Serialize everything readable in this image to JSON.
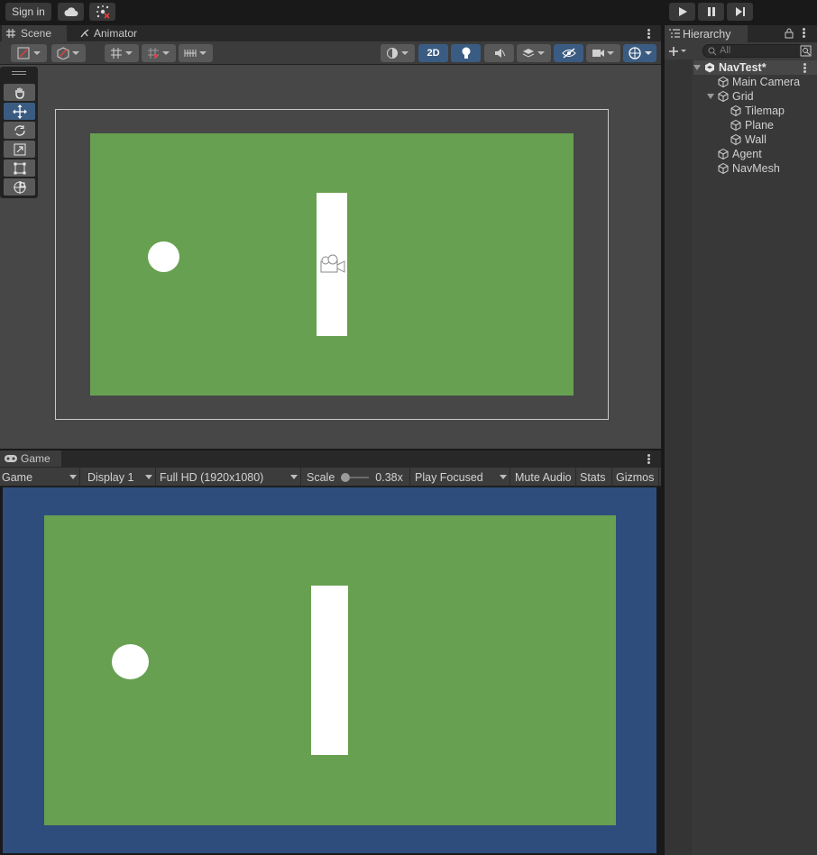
{
  "topbar": {
    "signin_label": "Sign in",
    "cloud_icon": "cloud-icon",
    "collab_icon": "collab-icon",
    "play_icon": "play-icon",
    "pause_icon": "pause-icon",
    "step_icon": "step-icon"
  },
  "scene": {
    "tabs": [
      {
        "label": "Scene",
        "icon": "grid-icon",
        "active": true
      },
      {
        "label": "Animator",
        "icon": "animator-icon",
        "active": false
      }
    ],
    "toolbar": {
      "mode_2d": "2D"
    },
    "tools": [
      "hand-tool-icon",
      "move-tool-icon",
      "rotate-tool-icon",
      "scale-tool-icon",
      "rect-tool-icon",
      "transform-tool-icon"
    ],
    "active_tool": "move-tool-icon"
  },
  "game": {
    "tab_label": "Game",
    "toolbar": {
      "view_select": "Game",
      "display_select": "Display 1",
      "resolution_select": "Full HD (1920x1080)",
      "scale_label": "Scale",
      "scale_value": "0.38x",
      "play_mode_select": "Play Focused",
      "mute_audio": "Mute Audio",
      "stats": "Stats",
      "gizmos": "Gizmos"
    }
  },
  "hierarchy": {
    "tab_label": "Hierarchy",
    "search_placeholder": "All",
    "items": [
      {
        "label": "NavTest*",
        "level": 0,
        "root": true,
        "expanded": true
      },
      {
        "label": "Main Camera",
        "level": 1
      },
      {
        "label": "Grid",
        "level": 1,
        "expanded": true
      },
      {
        "label": "Tilemap",
        "level": 2
      },
      {
        "label": "Plane",
        "level": 2
      },
      {
        "label": "Wall",
        "level": 2
      },
      {
        "label": "Agent",
        "level": 1
      },
      {
        "label": "NavMesh",
        "level": 1
      }
    ]
  },
  "colors": {
    "tilemap_green": "#67a051",
    "game_background": "#2f4d7c",
    "scene_background": "#474747",
    "accent_blue": "#3b5c82"
  }
}
